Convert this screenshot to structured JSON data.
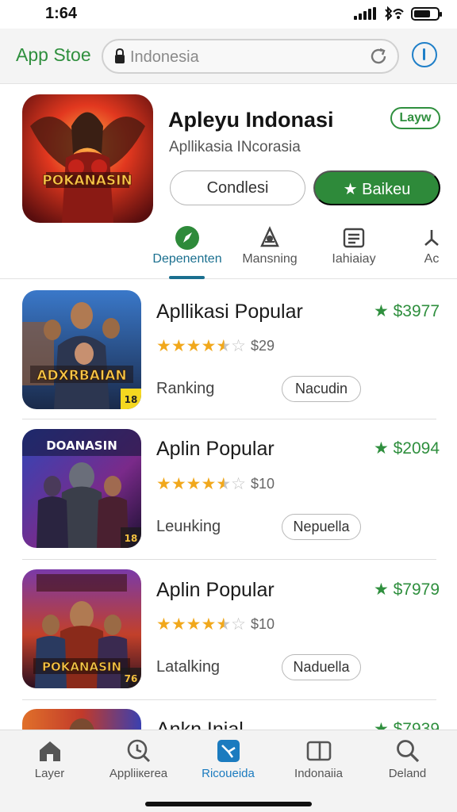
{
  "status": {
    "time": "1:64"
  },
  "header": {
    "app_title": "App Stoe",
    "search_text": "Indonesia"
  },
  "featured": {
    "title": "Apleyu Indonasi",
    "badge": "Layw",
    "subtitle": "Apllikasia INcorasia",
    "icon_text": "POKANASIN",
    "secondary_button": "Condlesi",
    "primary_button": "★ Baikeu"
  },
  "tabs": [
    {
      "label": "Depenenten",
      "icon": "compass-icon",
      "active": true
    },
    {
      "label": "Mansning",
      "icon": "joystick-icon",
      "active": false
    },
    {
      "label": "Iahiaiay",
      "icon": "list-icon",
      "active": false
    },
    {
      "label": "Ac",
      "icon": "arcade-icon",
      "active": false
    }
  ],
  "list": [
    {
      "title": "Apllikasi Popular",
      "price": "★ $3977",
      "rating": 4.5,
      "rating_text": "$29",
      "label": "Ranking",
      "pill": "Nacudin",
      "thumb_text": "ADXRBAIAN",
      "thumb_badge": "18"
    },
    {
      "title": "Aplin Popular",
      "price": "★ $2094",
      "rating": 4.5,
      "rating_text": "$10",
      "label": "Leuнking",
      "pill": "Nepuella",
      "thumb_text": "DOANASIN",
      "thumb_badge": "18"
    },
    {
      "title": "Aplin Popular",
      "price": "★ $7979",
      "rating": 4.5,
      "rating_text": "$10",
      "label": "Latalking",
      "pill": "Naduella",
      "thumb_text": "POKANASIN",
      "thumb_badge": "76"
    },
    {
      "title": "Ankn Inial",
      "price": "★ $7939"
    }
  ],
  "bottom_nav": [
    {
      "label": "Layer",
      "icon": "home-icon",
      "active": false
    },
    {
      "label": "Appliікerea",
      "icon": "clock-search-icon",
      "active": false
    },
    {
      "label": "Ricoueida",
      "icon": "rocket-app-icon",
      "active": true
    },
    {
      "label": "Indonaiia",
      "icon": "window-icon",
      "active": false
    },
    {
      "label": "Deland",
      "icon": "search-icon",
      "active": false
    }
  ],
  "colors": {
    "accent_green": "#2e8a3a",
    "accent_blue": "#1b7bbf",
    "star": "#f1a81c"
  }
}
